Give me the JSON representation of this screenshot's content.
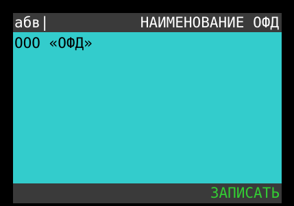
{
  "header": {
    "input_mode": "абв|",
    "title": "НАИМЕНОВАНИЕ ОФД"
  },
  "field": {
    "value": "ООО «ОФД»"
  },
  "footer": {
    "softkey_label": "ЗАПИСАТЬ"
  },
  "colors": {
    "background": "#000000",
    "bar": "#3a3a3a",
    "field": "#33cccc",
    "softkey": "#33cc33",
    "header_text": "#ffffff",
    "field_text": "#000000"
  }
}
